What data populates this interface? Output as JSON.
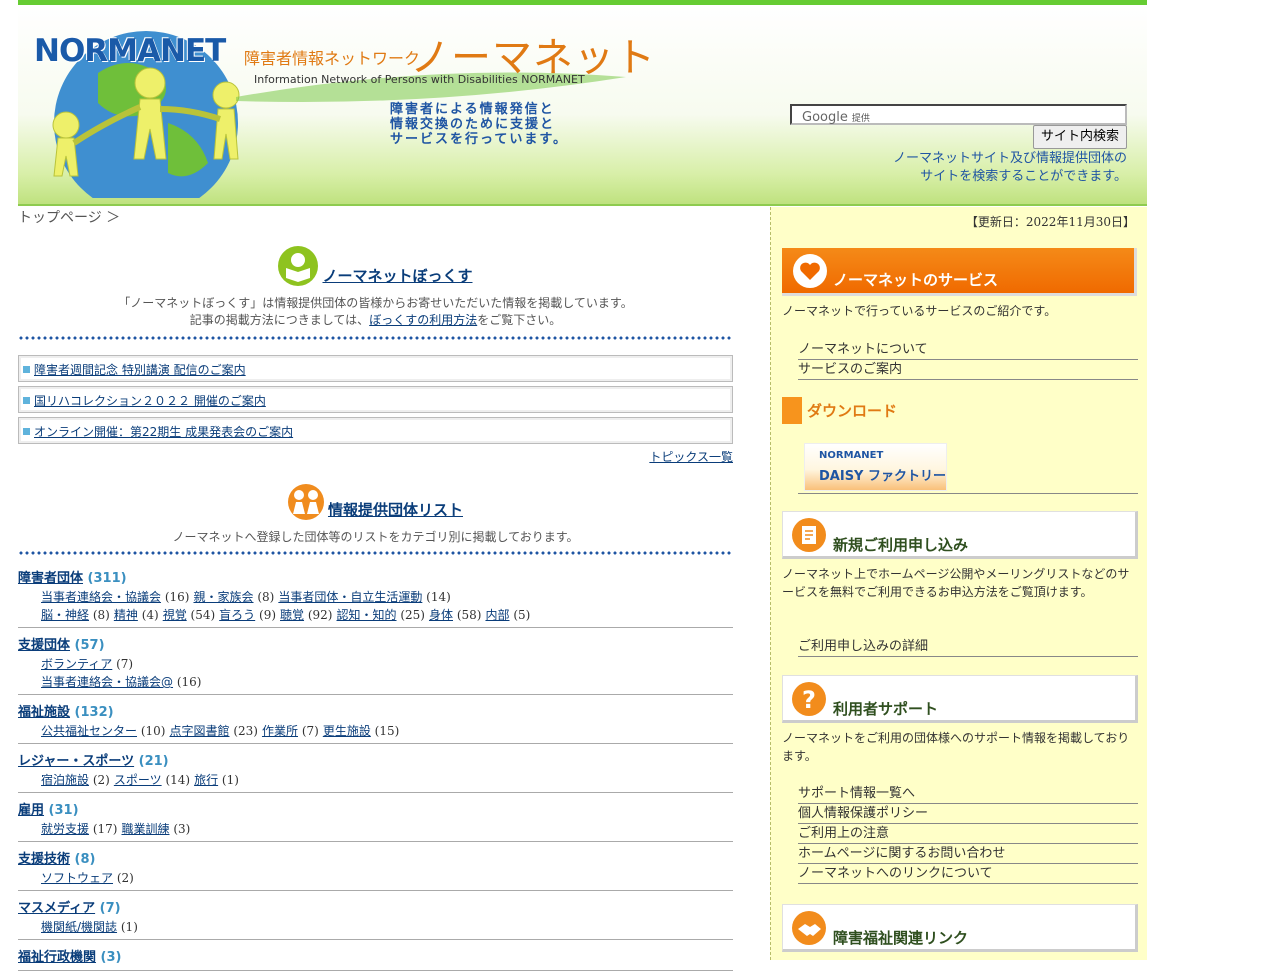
{
  "header": {
    "logo": "NORMANET",
    "subtitle": "障害者情報ネットワーク",
    "site_name": "ノーマネット",
    "english_name": "Information Network of Persons with Disabilities NORMANET",
    "tagline": [
      "障害者による情報発信と",
      "情報交換のために支援と",
      "サービスを行っています。"
    ],
    "search": {
      "google_label": "Google",
      "provided_label": "提供",
      "button_label": "サイト内検索",
      "description": "ノーマネットサイト及び情報提供団体の\nサイトを検索することができます。"
    },
    "colors": {
      "accent_green": "#66cc33",
      "brand_orange": "#e07a14",
      "brand_blue": "#1f55a3"
    }
  },
  "breadcrumb": "トップページ ＞",
  "box": {
    "title": "ノーマネットぼっくす",
    "desc_line1": "「ノーマネットぼっくす」は情報提供団体の皆様からお寄せいただいた情報を掲載しています。",
    "desc_line2_pre": "記事の掲載方法につきましては、",
    "desc_line2_link": "ぼっくすの利用方法",
    "desc_line2_post": "をご覧下さい。",
    "topics": [
      "障害者週間記念 特別講演 配信のご案内",
      "国リハコレクション２０２２ 開催のご案内",
      "オンライン開催：第22期生 成果発表会のご案内"
    ],
    "topics_all": "トピックス一覧"
  },
  "groups": {
    "title": "情報提供団体リスト",
    "desc": "ノーマネットへ登録した団体等のリストをカテゴリ別に掲載しております。",
    "categories": [
      {
        "name": "障害者団体",
        "count": "(311)",
        "lines": [
          [
            [
              "当事者連絡会・協議会",
              "(16)"
            ],
            [
              "親・家族会",
              "(8)"
            ],
            [
              "当事者団体・自立生活運動",
              "(14)"
            ]
          ],
          [
            [
              "脳・神経",
              "(8)"
            ],
            [
              "精神",
              "(4)"
            ],
            [
              "視覚",
              "(54)"
            ],
            [
              "盲ろう",
              "(9)"
            ],
            [
              "聴覚",
              "(92)"
            ],
            [
              "認知・知的",
              "(25)"
            ],
            [
              "身体",
              "(58)"
            ],
            [
              "内部",
              "(5)"
            ]
          ]
        ]
      },
      {
        "name": "支援団体",
        "count": "(57)",
        "lines": [
          [
            [
              "ボランティア",
              "(7)"
            ]
          ],
          [
            [
              "当事者連絡会・協議会@",
              "(16)"
            ]
          ]
        ]
      },
      {
        "name": "福祉施設",
        "count": "(132)",
        "lines": [
          [
            [
              "公共福祉センター",
              "(10)"
            ],
            [
              "点字図書館",
              "(23)"
            ],
            [
              "作業所",
              "(7)"
            ],
            [
              "更生施設",
              "(15)"
            ]
          ]
        ]
      },
      {
        "name": "レジャー・スポーツ",
        "count": "(21)",
        "lines": [
          [
            [
              "宿泊施設",
              "(2)"
            ],
            [
              "スポーツ",
              "(14)"
            ],
            [
              "旅行",
              "(1)"
            ]
          ]
        ]
      },
      {
        "name": "雇用",
        "count": "(31)",
        "lines": [
          [
            [
              "就労支援",
              "(17)"
            ],
            [
              "職業訓練",
              "(3)"
            ]
          ]
        ]
      },
      {
        "name": "支援技術",
        "count": "(8)",
        "lines": [
          [
            [
              "ソフトウェア",
              "(2)"
            ]
          ]
        ]
      },
      {
        "name": "マスメディア",
        "count": "(7)",
        "lines": [
          [
            [
              "機関紙/機関誌",
              "(1)"
            ]
          ]
        ]
      },
      {
        "name": "福祉行政機関",
        "count": "(3)",
        "lines": []
      }
    ]
  },
  "sidebar": {
    "updated": "【更新日：2022年11月30日】",
    "service": {
      "title": "ノーマネットのサービス",
      "desc": "ノーマネットで行っているサービスのご紹介です。",
      "links": [
        "ノーマネットについて",
        "サービスのご案内"
      ]
    },
    "download": {
      "title": "ダウンロード",
      "banner_top": "NORMANET",
      "banner_main": "DAISY ファクトリー"
    },
    "signup": {
      "title": "新規ご利用申し込み",
      "desc": "ノーマネット上でホームページ公開やメーリングリストなどのサービスを無料でご利用できるお申込方法をご覧頂けます。",
      "links": [
        "ご利用申し込みの詳細"
      ]
    },
    "support": {
      "title": "利用者サポート",
      "desc": "ノーマネットをご利用の団体様へのサポート情報を掲載しております。",
      "links": [
        "サポート情報一覧へ",
        "個人情報保護ポリシー",
        "ご利用上の注意",
        "ホームページに関するお問い合わせ",
        "ノーマネットへのリンクについて"
      ]
    },
    "links_section": {
      "title": "障害福祉関連リンク"
    }
  }
}
